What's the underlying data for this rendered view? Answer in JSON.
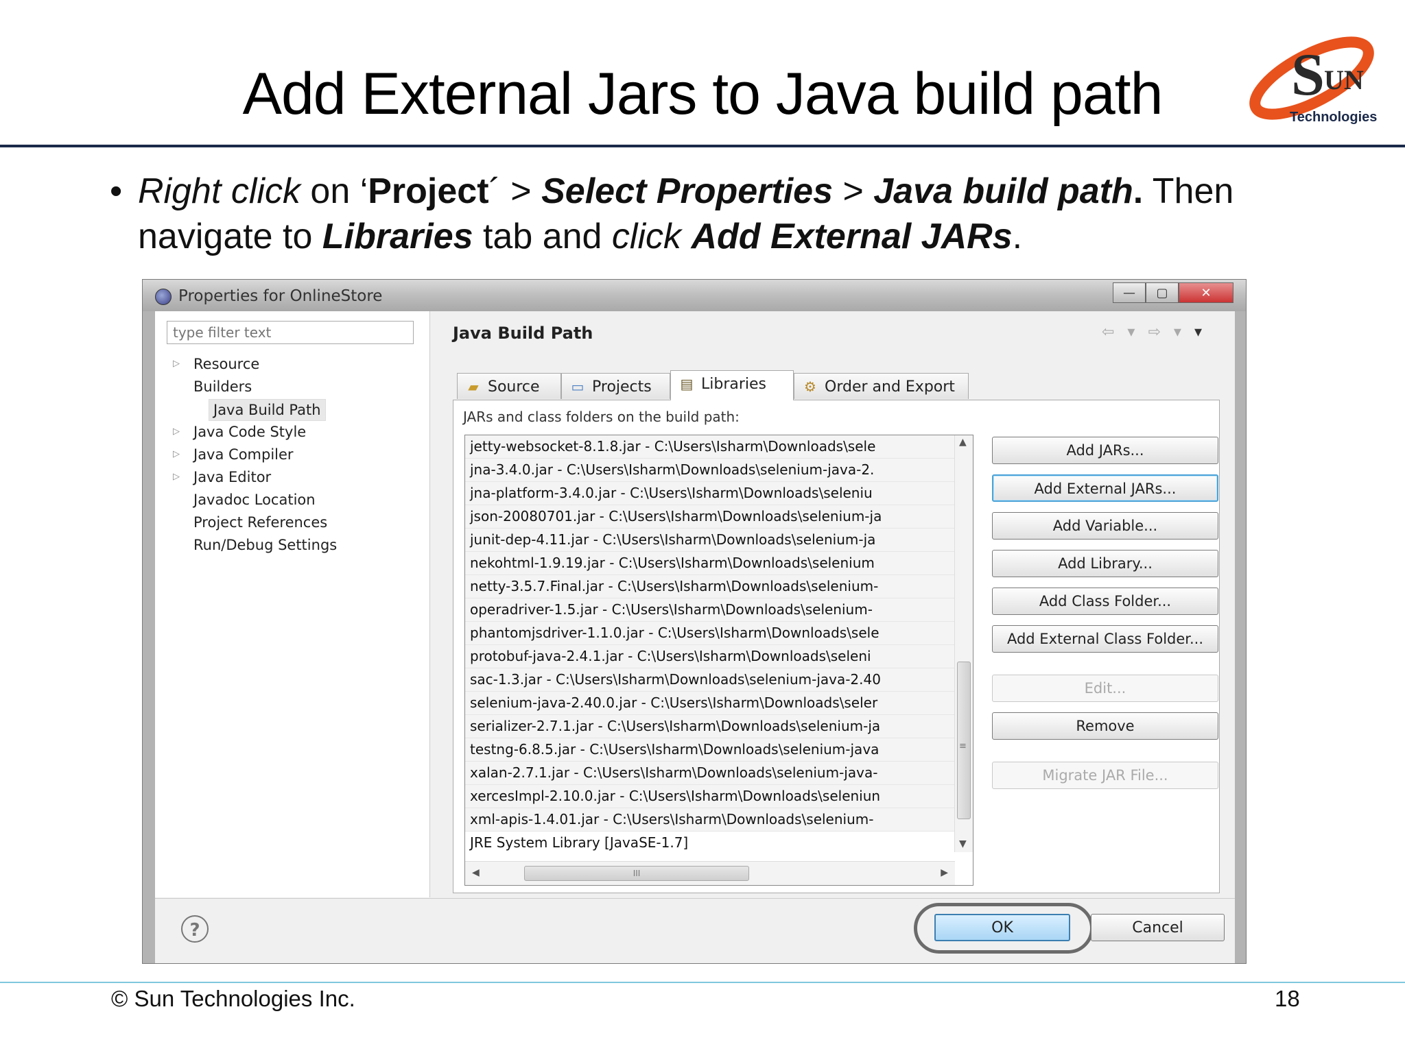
{
  "slide": {
    "title": "Add External Jars to Java build path",
    "logo_text": "Technologies",
    "bullet_symbol": "•",
    "bullet": {
      "p1": "Right click",
      "p2": " on ‘",
      "p3": "Project",
      "p4": "´ > ",
      "p5": "Select Properties",
      "p6": " > ",
      "p7": "Java build path",
      "p8": ".",
      "p9": " Then navigate to ",
      "p10": "Libraries",
      "p11": " tab and ",
      "p12": "click",
      "p13": " ",
      "p14": "Add External JARs",
      "p15": "."
    },
    "footer_copyright": "© Sun Technologies Inc.",
    "page_number": "18"
  },
  "dialog": {
    "title": "Properties for OnlineStore",
    "window_buttons": {
      "minimize": "—",
      "maximize": "▢",
      "close": "✕"
    },
    "filter_placeholder": "type filter text",
    "nav_items": [
      {
        "label": "Resource",
        "arrow": "▷"
      },
      {
        "label": "Builders"
      },
      {
        "label": "Java Build Path"
      },
      {
        "label": "Java Code Style",
        "arrow": "▷"
      },
      {
        "label": "Java Compiler",
        "arrow": "▷"
      },
      {
        "label": "Java Editor",
        "arrow": "▷"
      },
      {
        "label": "Javadoc Location"
      },
      {
        "label": "Project References"
      },
      {
        "label": "Run/Debug Settings"
      }
    ],
    "section_title": "Java Build Path",
    "history_nav": {
      "back": "⇦ ▾",
      "forward": "⇨ ▾",
      "menu": "▾"
    },
    "tabs": [
      {
        "label": "Source",
        "icon": "📂"
      },
      {
        "label": "Projects",
        "icon": "🗁"
      },
      {
        "label": "Libraries",
        "icon": "▬"
      },
      {
        "label": "Order and Export",
        "icon": "⚙"
      }
    ],
    "active_tab": "Libraries",
    "panel_label": "JARs and class folders on the build path:",
    "jars": [
      "jetty-websocket-8.1.8.jar - C:\\Users\\Isharm\\Downloads\\sele",
      "jna-3.4.0.jar - C:\\Users\\Isharm\\Downloads\\selenium-java-2.",
      "jna-platform-3.4.0.jar - C:\\Users\\Isharm\\Downloads\\seleniu",
      "json-20080701.jar - C:\\Users\\Isharm\\Downloads\\selenium-ja",
      "junit-dep-4.11.jar - C:\\Users\\Isharm\\Downloads\\selenium-ja",
      "nekohtml-1.9.19.jar - C:\\Users\\Isharm\\Downloads\\selenium",
      "netty-3.5.7.Final.jar - C:\\Users\\Isharm\\Downloads\\selenium-",
      "operadriver-1.5.jar - C:\\Users\\Isharm\\Downloads\\selenium-",
      "phantomjsdriver-1.1.0.jar - C:\\Users\\Isharm\\Downloads\\sele",
      "protobuf-java-2.4.1.jar - C:\\Users\\Isharm\\Downloads\\seleni",
      "sac-1.3.jar - C:\\Users\\Isharm\\Downloads\\selenium-java-2.40",
      "selenium-java-2.40.0.jar - C:\\Users\\Isharm\\Downloads\\seler",
      "serializer-2.7.1.jar - C:\\Users\\Isharm\\Downloads\\selenium-ja",
      "testng-6.8.5.jar - C:\\Users\\Isharm\\Downloads\\selenium-java",
      "xalan-2.7.1.jar - C:\\Users\\Isharm\\Downloads\\selenium-java-",
      "xercesImpl-2.10.0.jar - C:\\Users\\Isharm\\Downloads\\seleniun",
      "xml-apis-1.4.01.jar - C:\\Users\\Isharm\\Downloads\\selenium-",
      "JRE System Library [JavaSE-1.7]"
    ],
    "scroll_glyphs": {
      "up": "▲",
      "down": "▼",
      "left": "◀",
      "right": "▶",
      "grip": "≡",
      "hgrip": "III"
    },
    "buttons": [
      {
        "label": "Add JARs...",
        "state": "normal"
      },
      {
        "label": "Add External JARs...",
        "state": "focused"
      },
      {
        "label": "Add Variable...",
        "state": "normal"
      },
      {
        "label": "Add Library...",
        "state": "normal"
      },
      {
        "label": "Add Class Folder...",
        "state": "normal"
      },
      {
        "label": "Add External Class Folder...",
        "state": "normal"
      },
      {
        "label": "Edit...",
        "state": "disabled"
      },
      {
        "label": "Remove",
        "state": "normal"
      },
      {
        "label": "Migrate JAR File...",
        "state": "disabled"
      }
    ],
    "help_glyph": "?",
    "ok_label": "OK",
    "cancel_label": "Cancel"
  },
  "colors": {
    "title_rule": "#1b2a4a",
    "footer_rule": "#7fc7dc",
    "logo_orange": "#e8521c",
    "focus_blue": "#4aa3d8"
  },
  "icons": {
    "logo": "sun-technologies-logo",
    "help": "help-icon",
    "tab_source": "folder-icon",
    "tab_projects": "project-icon",
    "tab_libraries": "library-icon",
    "tab_order": "order-export-icon"
  }
}
